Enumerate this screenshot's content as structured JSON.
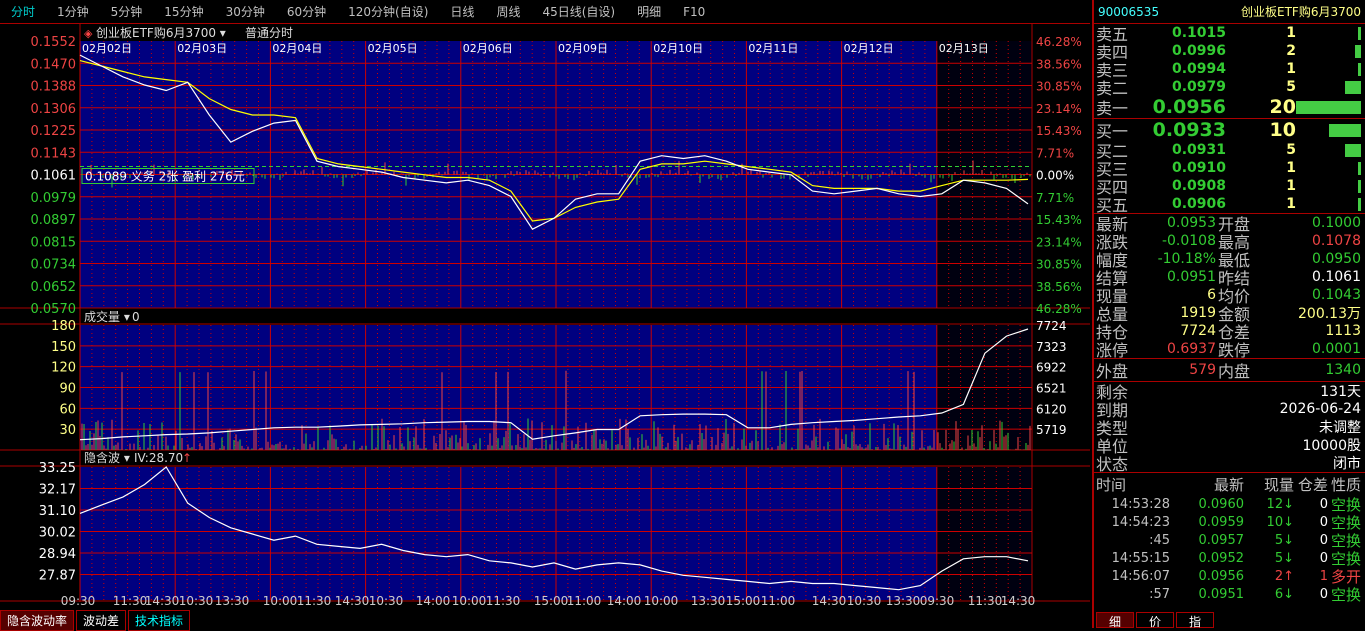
{
  "toolbar": [
    "分时",
    "1分钟",
    "5分钟",
    "15分钟",
    "30分钟",
    "60分钟",
    "120分钟(自设)",
    "日线",
    "周线",
    "45日线(自设)",
    "明细",
    "F10"
  ],
  "chart": {
    "title": "创业板ETF购6月3700",
    "mode": "普通分时",
    "dates": [
      "02月02日",
      "02月03日",
      "02月04日",
      "02月05日",
      "02月06日",
      "02月09日",
      "02月10日",
      "02月11日",
      "02月12日",
      "02月13日"
    ],
    "price_ticks": [
      "0.1552",
      "0.1470",
      "0.1388",
      "0.1306",
      "0.1225",
      "0.1143",
      "0.1061",
      "0.0979",
      "0.0897",
      "0.0815",
      "0.0734",
      "0.0652",
      "0.0570"
    ],
    "pct_ticks": [
      "46.28%",
      "38.56%",
      "30.85%",
      "23.14%",
      "15.43%",
      "7.71%",
      "0.00%",
      "7.71%",
      "15.43%",
      "23.14%",
      "30.85%",
      "38.56%",
      "46.28%"
    ],
    "position_label": "0.1089 义务 2张 盈利 276元",
    "volume_title": "成交量",
    "volume_value": "0",
    "vol_ticks": [
      "180",
      "150",
      "120",
      "90",
      "60",
      "30"
    ],
    "oi_ticks": [
      "7724",
      "7323",
      "6922",
      "6521",
      "6120",
      "5719"
    ],
    "iv_title": "隐含波",
    "iv_value": "IV:28.70",
    "iv_ticks": [
      "33.25",
      "32.17",
      "31.10",
      "30.02",
      "28.94",
      "27.87"
    ],
    "time_labels": [
      "09:30",
      "11:30",
      "14:30",
      "10:30",
      "13:30",
      "10:00",
      "11:30",
      "14:30",
      "10:30",
      "14:00",
      "10:00",
      "11:30",
      "15:00",
      "11:00",
      "14:00",
      "10:00",
      "13:30",
      "15:00",
      "11:00",
      "14:30",
      "10:30",
      "13:30",
      "09:30",
      "11:30",
      "14:30"
    ],
    "price_series": [
      0.15,
      0.146,
      0.142,
      0.139,
      0.137,
      0.14,
      0.128,
      0.118,
      0.122,
      0.125,
      0.126,
      0.111,
      0.109,
      0.108,
      0.107,
      0.105,
      0.104,
      0.103,
      0.104,
      0.102,
      0.098,
      0.086,
      0.09,
      0.097,
      0.099,
      0.099,
      0.111,
      0.113,
      0.112,
      0.113,
      0.111,
      0.108,
      0.107,
      0.106,
      0.1,
      0.099,
      0.1,
      0.101,
      0.099,
      0.098,
      0.099,
      0.104,
      0.103,
      0.101,
      0.0953
    ],
    "avg_series": [
      0.148,
      0.146,
      0.144,
      0.142,
      0.141,
      0.14,
      0.134,
      0.13,
      0.128,
      0.128,
      0.127,
      0.112,
      0.11,
      0.109,
      0.108,
      0.107,
      0.106,
      0.105,
      0.105,
      0.104,
      0.1,
      0.089,
      0.09,
      0.094,
      0.096,
      0.097,
      0.108,
      0.11,
      0.11,
      0.111,
      0.11,
      0.109,
      0.108,
      0.107,
      0.102,
      0.101,
      0.101,
      0.101,
      0.1,
      0.1,
      0.102,
      0.104,
      0.104,
      0.104,
      0.1043
    ],
    "iv_series": [
      31.0,
      31.4,
      31.8,
      32.4,
      33.25,
      31.5,
      30.8,
      30.3,
      30.0,
      29.7,
      29.9,
      29.5,
      29.4,
      29.3,
      29.5,
      29.2,
      29.0,
      28.9,
      29.0,
      28.7,
      28.6,
      28.4,
      28.6,
      28.3,
      28.5,
      28.6,
      28.5,
      28.2,
      28.0,
      27.9,
      27.8,
      27.7,
      27.6,
      27.7,
      27.6,
      27.6,
      27.5,
      27.4,
      27.3,
      27.5,
      28.2,
      28.8,
      28.9,
      28.9,
      28.7
    ],
    "oi_series": [
      5780,
      5800,
      5830,
      5850,
      5870,
      5880,
      5900,
      5930,
      5960,
      5990,
      6000,
      6000,
      6020,
      6040,
      6050,
      6060,
      6080,
      6090,
      6100,
      6100,
      6080,
      5790,
      5850,
      5900,
      5960,
      5960,
      6200,
      6220,
      6230,
      6230,
      6220,
      5990,
      5990,
      6050,
      6080,
      6100,
      6120,
      6150,
      6180,
      6200,
      6250,
      6400,
      7300,
      7600,
      7724
    ]
  },
  "quote": {
    "code": "90006535",
    "name": "创业板ETF购6月3700",
    "asks": [
      {
        "label": "卖五",
        "price": "0.1015",
        "qty": "1",
        "fill": 0.05
      },
      {
        "label": "卖四",
        "price": "0.0996",
        "qty": "2",
        "fill": 0.1
      },
      {
        "label": "卖三",
        "price": "0.0994",
        "qty": "1",
        "fill": 0.05
      },
      {
        "label": "卖二",
        "price": "0.0979",
        "qty": "5",
        "fill": 0.25
      },
      {
        "label": "卖一",
        "price": "0.0956",
        "qty": "20",
        "fill": 1.0
      }
    ],
    "bids": [
      {
        "label": "买一",
        "price": "0.0933",
        "qty": "10",
        "fill": 0.5
      },
      {
        "label": "买二",
        "price": "0.0931",
        "qty": "5",
        "fill": 0.25
      },
      {
        "label": "买三",
        "price": "0.0910",
        "qty": "1",
        "fill": 0.05
      },
      {
        "label": "买四",
        "price": "0.0908",
        "qty": "1",
        "fill": 0.05
      },
      {
        "label": "买五",
        "price": "0.0906",
        "qty": "1",
        "fill": 0.05
      }
    ],
    "stats": [
      {
        "l1": "最新",
        "v1": "0.0953",
        "c1": "g",
        "l2": "开盘",
        "v2": "0.1000",
        "c2": "g"
      },
      {
        "l1": "涨跌",
        "v1": "-0.0108",
        "c1": "g",
        "l2": "最高",
        "v2": "0.1078",
        "c2": "r"
      },
      {
        "l1": "幅度",
        "v1": "-10.18%",
        "c1": "g",
        "l2": "最低",
        "v2": "0.0950",
        "c2": "g"
      },
      {
        "l1": "结算",
        "v1": "0.0951",
        "c1": "g",
        "l2": "昨结",
        "v2": "0.1061",
        "c2": "w"
      },
      {
        "l1": "现量",
        "v1": "6",
        "c1": "y",
        "l2": "均价",
        "v2": "0.1043",
        "c2": "g"
      },
      {
        "l1": "总量",
        "v1": "1919",
        "c1": "y",
        "l2": "金额",
        "v2": "200.13万",
        "c2": "y"
      },
      {
        "l1": "持仓",
        "v1": "7724",
        "c1": "y",
        "l2": "仓差",
        "v2": "1113",
        "c2": "y"
      },
      {
        "l1": "涨停",
        "v1": "0.6937",
        "c1": "r",
        "l2": "跌停",
        "v2": "0.0001",
        "c2": "g"
      }
    ],
    "outer": {
      "l1": "外盘",
      "v1": "579",
      "c1": "r",
      "l2": "内盘",
      "v2": "1340",
      "c2": "g"
    },
    "info": [
      {
        "l": "剩余",
        "v": "131天"
      },
      {
        "l": "到期",
        "v": "2026-06-24"
      },
      {
        "l": "类型",
        "v": "未调整"
      },
      {
        "l": "单位",
        "v": "10000股"
      },
      {
        "l": "状态",
        "v": "闭市"
      }
    ],
    "tick_header": [
      "时间",
      "最新",
      "现量",
      "仓差",
      "性质"
    ],
    "ticks": [
      {
        "t": "14:53:28",
        "p": "0.0960",
        "q": "12",
        "dir": "↓",
        "d": "0",
        "n": "空换"
      },
      {
        "t": "14:54:23",
        "p": "0.0959",
        "q": "10",
        "dir": "↓",
        "d": "0",
        "n": "空换"
      },
      {
        "t": ":45",
        "p": "0.0957",
        "q": "5",
        "dir": "↓",
        "d": "0",
        "n": "空换"
      },
      {
        "t": "14:55:15",
        "p": "0.0952",
        "q": "5",
        "dir": "↓",
        "d": "0",
        "n": "空换"
      },
      {
        "t": "14:56:07",
        "p": "0.0956",
        "q": "2",
        "dir": "↑",
        "d": "1",
        "n": "多开"
      },
      {
        "t": ":57",
        "p": "0.0951",
        "q": "6",
        "dir": "↓",
        "d": "0",
        "n": "空换"
      }
    ],
    "tabs": [
      "细",
      "价",
      "指"
    ]
  },
  "bottom_tabs": [
    "隐含波动率",
    "波动差",
    "技术指标"
  ],
  "colors": {
    "bg": "#000",
    "panel": "#000080",
    "grid": "#a00000",
    "up": "#e44",
    "down": "#3c3"
  }
}
